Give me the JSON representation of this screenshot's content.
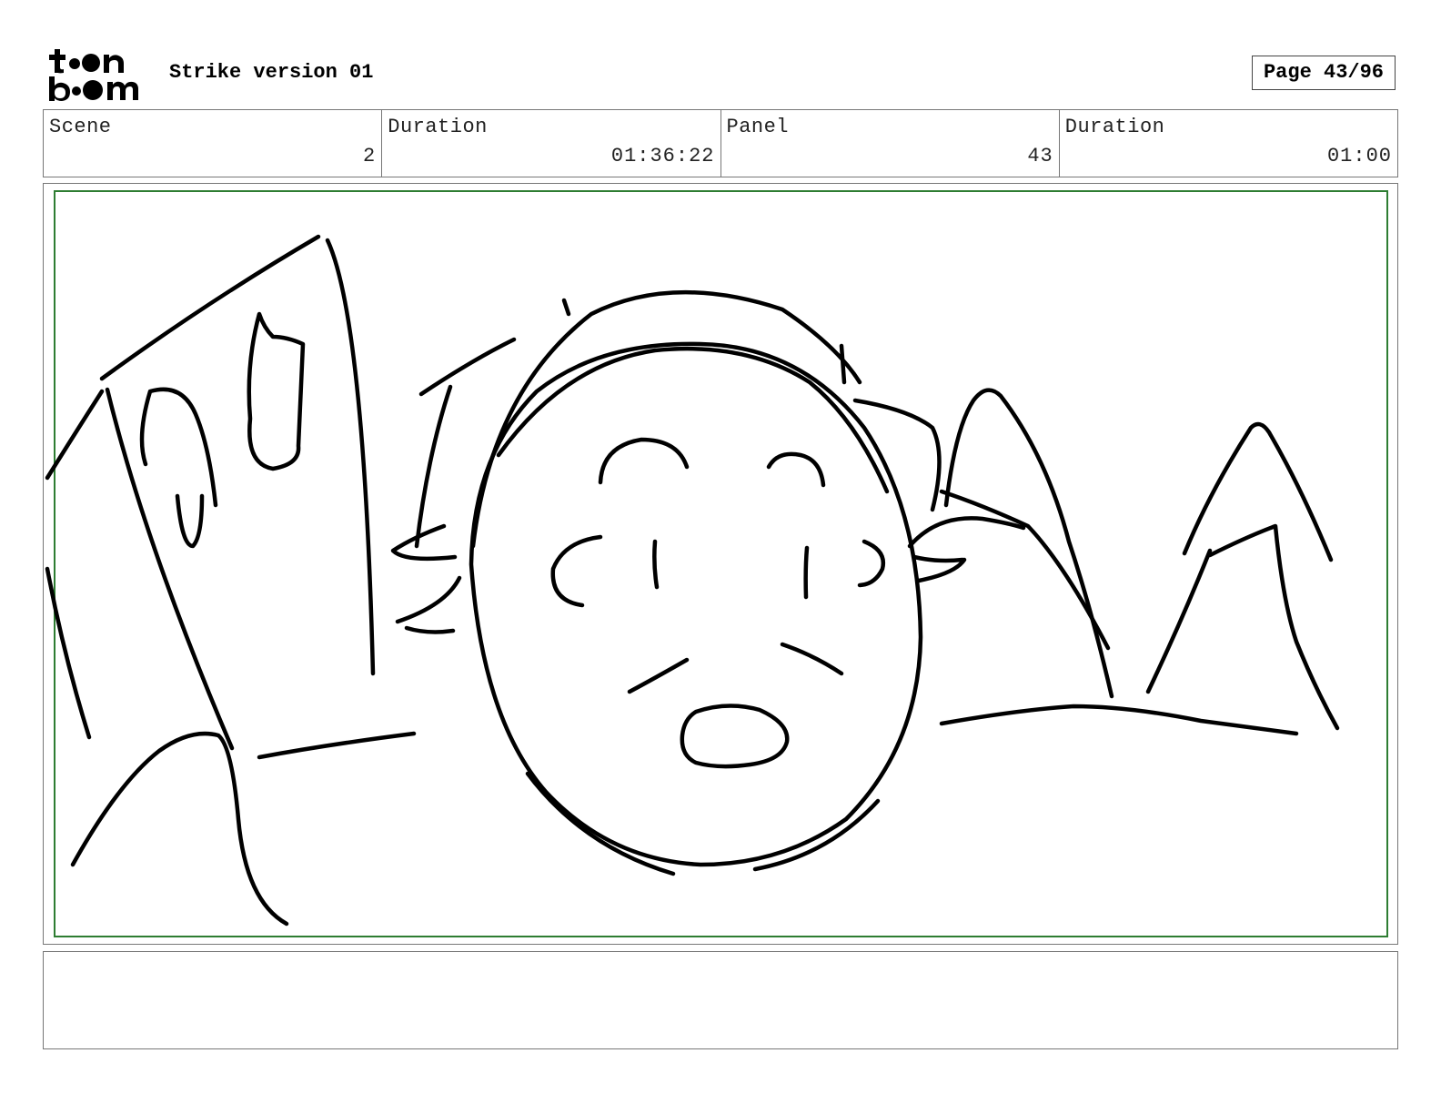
{
  "header": {
    "logo_text": "toon boom",
    "project_title": "Strike version 01",
    "page_indicator": "Page 43/96"
  },
  "info": {
    "scene_label": "Scene",
    "scene_value": "2",
    "scene_duration_label": "Duration",
    "scene_duration_value": "01:36:22",
    "panel_label": "Panel",
    "panel_value": "43",
    "panel_duration_label": "Duration",
    "panel_duration_value": "01:00"
  },
  "panel": {
    "safe_frame_color": "#2e7d32",
    "sketch_subject": "surprised-face-with-building-and-mountains"
  },
  "notes": {
    "text": ""
  }
}
